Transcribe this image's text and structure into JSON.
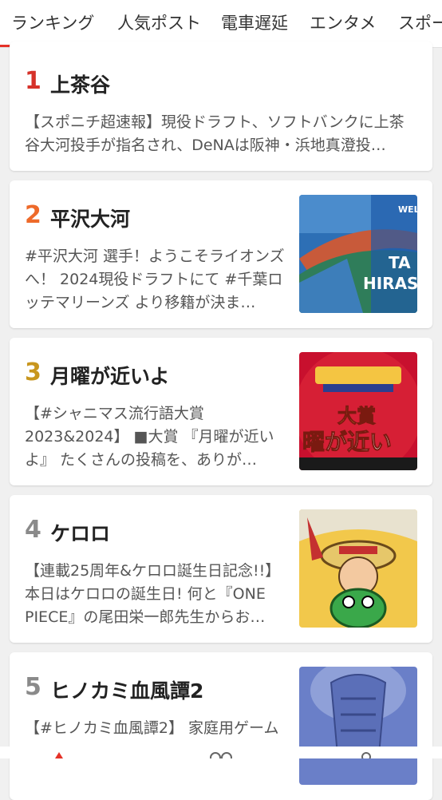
{
  "tabs": [
    "ランキング",
    "人気ポスト",
    "電車遅延",
    "エンタメ",
    "スポー"
  ],
  "accent_color": "#e53228",
  "items": [
    {
      "rank": "1",
      "rank_color": "#d6322a",
      "title": "上茶谷",
      "desc": "【スポニチ超速報】現役ドラフト、ソフトバンクに上茶谷大河投手が指名され、DeNAは阪神・浜地真澄投…"
    },
    {
      "rank": "2",
      "rank_color": "#ee6a2a",
      "title": "平沢大河",
      "desc": "#平沢大河 選手！ようこそライオンズへ！ 2024現役ドラフトにて #千葉ロッテマリーンズ より移籍が決ま…",
      "thumb_text": [
        "WEL",
        "TA",
        "HIRASA"
      ]
    },
    {
      "rank": "3",
      "rank_color": "#c8961e",
      "title": "月曜が近いよ",
      "desc": "【#シャニマス流行語大賞2023&2024】 ■大賞 『月曜が近いよ』 たくさんの投稿を、ありが…",
      "thumb_text": [
        "大賞",
        "曜が近い"
      ]
    },
    {
      "rank": "4",
      "rank_color": "#8a8a8a",
      "title": "ケロロ",
      "desc": "【連載25周年&ケロロ誕生日記念!!】本日はケロロの誕生日! 何と『ONE PIECE』の尾田栄一郎先生からお…"
    },
    {
      "rank": "5",
      "rank_color": "#8a8a8a",
      "title": "ヒノカミ血風譚2",
      "desc": "【#ヒノカミ血風譚2】 家庭用ゲーム"
    }
  ]
}
